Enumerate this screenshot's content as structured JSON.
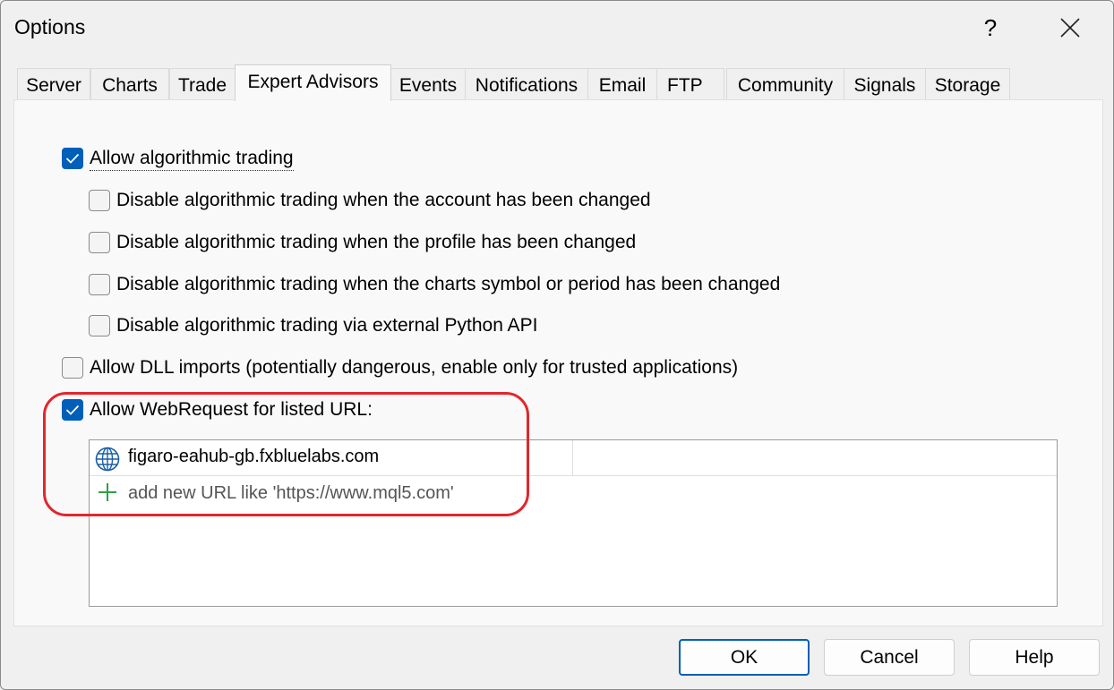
{
  "window": {
    "title": "Options",
    "help_label": "?",
    "close_icon": "close-icon"
  },
  "tabs": [
    {
      "label": "Server"
    },
    {
      "label": "Charts"
    },
    {
      "label": "Trade"
    },
    {
      "label": "Expert Advisors",
      "active": true
    },
    {
      "label": "Events"
    },
    {
      "label": "Notifications"
    },
    {
      "label": "Email"
    },
    {
      "label": "FTP"
    },
    {
      "label": "Community"
    },
    {
      "label": "Signals"
    },
    {
      "label": "Storage"
    }
  ],
  "options": [
    {
      "label": "Allow algorithmic trading",
      "checked": true
    },
    {
      "label": "Disable algorithmic trading when the account has been changed",
      "checked": false
    },
    {
      "label": "Disable algorithmic trading when the profile has been changed",
      "checked": false
    },
    {
      "label": "Disable algorithmic trading when the charts symbol or period has been changed",
      "checked": false
    },
    {
      "label": "Disable algorithmic trading via external Python API",
      "checked": false
    },
    {
      "label": "Allow DLL imports (potentially dangerous, enable only for trusted applications)",
      "checked": false
    },
    {
      "label": "Allow WebRequest for listed URL:",
      "checked": true
    }
  ],
  "url_list": {
    "urls": [
      {
        "url": "figaro-eahub-gb.fxbluelabs.com",
        "icon": "globe-icon"
      }
    ],
    "add_placeholder": "add new URL like 'https://www.mql5.com'",
    "add_icon": "plus-icon"
  },
  "buttons": {
    "ok": "OK",
    "cancel": "Cancel",
    "help": "Help"
  },
  "colors": {
    "accent": "#005fb8",
    "highlight": "#e3262c",
    "add_icon": "#2ea043"
  }
}
